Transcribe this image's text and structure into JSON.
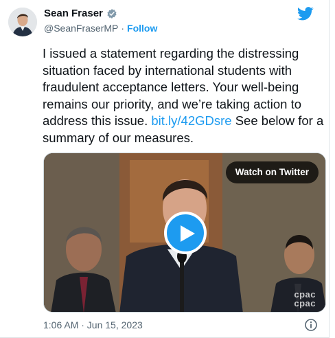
{
  "author": {
    "name": "Sean Fraser",
    "handle": "@SeanFraserMP",
    "separator": "·",
    "follow_label": "Follow"
  },
  "tweet": {
    "text_before_link": "I issued a statement regarding the distressing situation faced by international students with fraudulent acceptance letters. Your well-being remains our priority, and we’re taking action to address this issue. ",
    "link_text": "bit.ly/42GDsre",
    "text_after_link": " See below for a summary of our measures."
  },
  "media": {
    "watch_label": "Watch on Twitter",
    "watermark_line1": "cpac",
    "watermark_line2": "cpac"
  },
  "footer": {
    "timestamp": "1:06 AM · Jun 15, 2023"
  },
  "colors": {
    "accent": "#1d9bf0",
    "text": "#0f1419",
    "muted": "#536471"
  },
  "icons": {
    "verified": "verified-badge-icon",
    "brand": "twitter-bird-icon",
    "play": "play-icon",
    "info": "info-icon"
  }
}
